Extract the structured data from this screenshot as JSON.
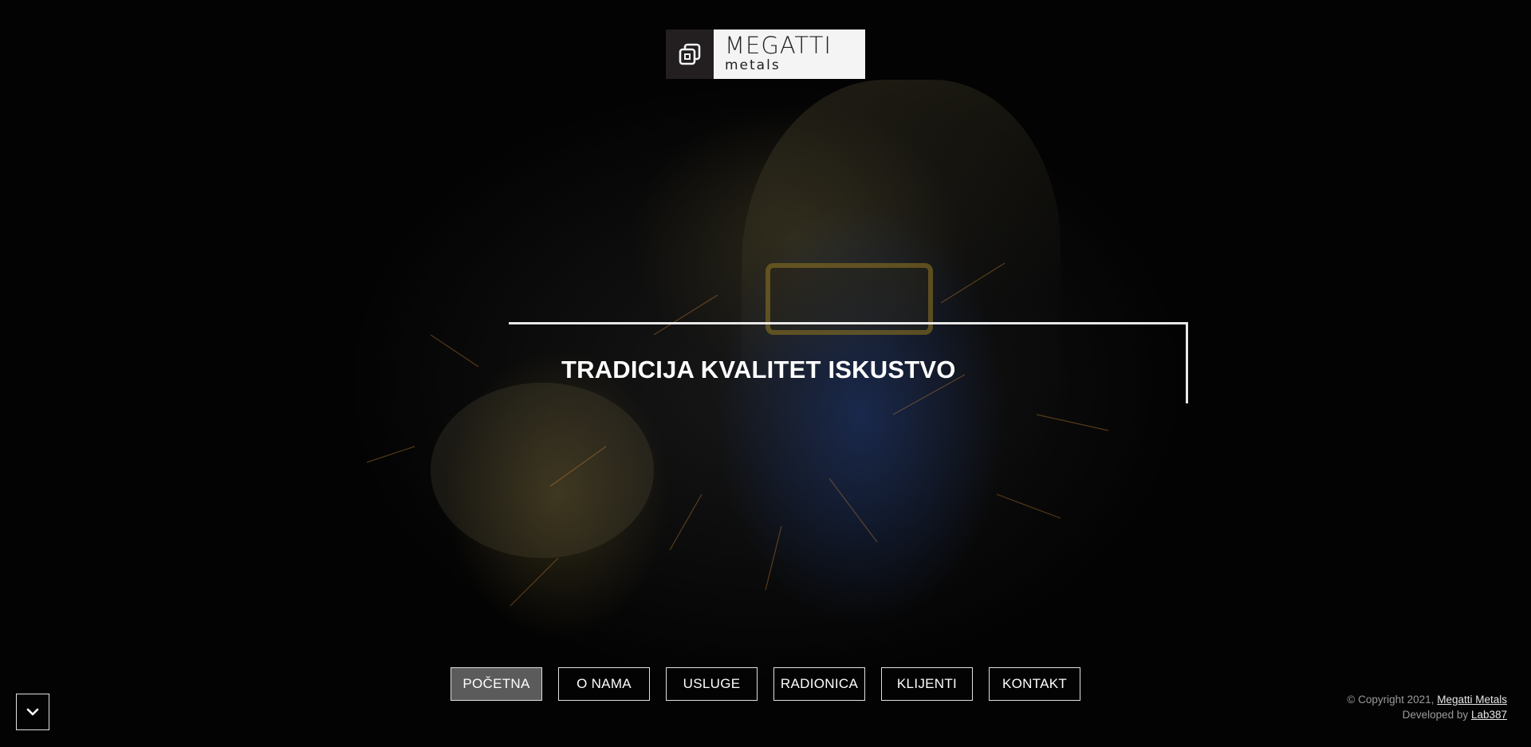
{
  "logo": {
    "name": "MEGATTI",
    "sub": "metals",
    "mark_icon": "megatti-logo-icon"
  },
  "hero": {
    "headline": "TRADICIJA KVALITET ISKUSTVO"
  },
  "nav": {
    "items": [
      {
        "label": "POČETNA",
        "active": true
      },
      {
        "label": "O NAMA",
        "active": false
      },
      {
        "label": "USLUGE",
        "active": false
      },
      {
        "label": "RADIONICA",
        "active": false
      },
      {
        "label": "KLIJENTI",
        "active": false
      },
      {
        "label": "KONTAKT",
        "active": false
      }
    ]
  },
  "scroll_button": {
    "icon": "chevron-down-icon"
  },
  "footer": {
    "copyright_prefix": "© Copyright 2021,",
    "company_link": "Megatti Metals",
    "developed_prefix": "Developed by",
    "developer_link": "Lab387"
  },
  "colors": {
    "background": "#030303",
    "logo_dark": "#231f20",
    "logo_light": "#f4f4f4",
    "active_nav": "#5b5b5b"
  }
}
